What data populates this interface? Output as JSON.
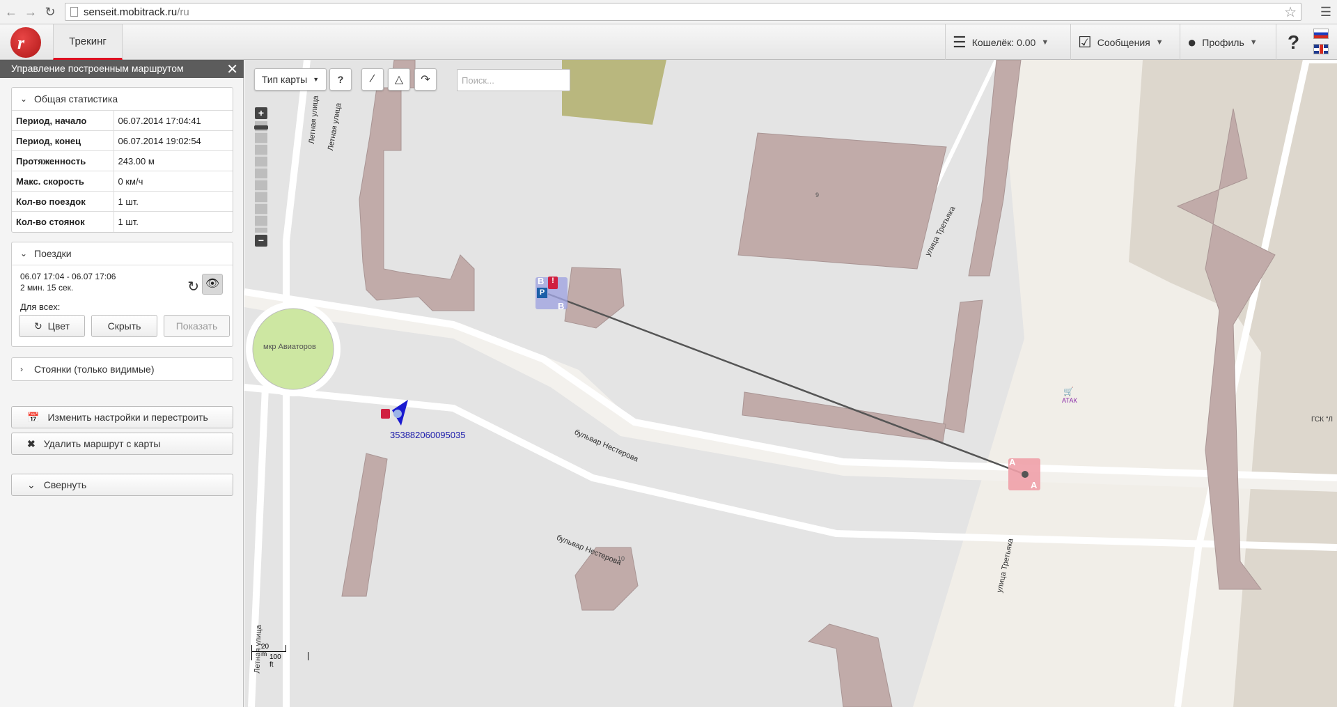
{
  "browser": {
    "url_host": "senseit.mobitrack.ru",
    "url_path": "/ru"
  },
  "header": {
    "tab_tracking": "Трекинг",
    "wallet": "Кошелёк: 0.00",
    "messages": "Сообщения",
    "profile": "Профиль",
    "help": "?"
  },
  "sidebar": {
    "title": "Управление построенным маршрутом",
    "general_stats": {
      "heading": "Общая статистика",
      "rows": [
        {
          "key": "Период, начало",
          "value": "06.07.2014 17:04:41"
        },
        {
          "key": "Период, конец",
          "value": "06.07.2014 19:02:54"
        },
        {
          "key": "Протяженность",
          "value": "243.00 м"
        },
        {
          "key": "Макс. скорость",
          "value": "0 км/ч"
        },
        {
          "key": "Кол-во поездок",
          "value": "1 шт."
        },
        {
          "key": "Кол-во стоянок",
          "value": "1 шт."
        }
      ]
    },
    "trips": {
      "heading": "Поездки",
      "trip_range": "06.07 17:04 - 06.07 17:06",
      "trip_duration": "2 мин. 15 сек.",
      "for_all": "Для всех:",
      "color_btn": "Цвет",
      "hide_btn": "Скрыть",
      "show_btn": "Показать"
    },
    "stops": {
      "heading": "Стоянки (только видимые)"
    },
    "change_settings_btn": "Изменить настройки и перестроить",
    "delete_route_btn": "Удалить маршрут с карты",
    "collapse_btn": "Свернуть"
  },
  "map": {
    "map_type_btn": "Тип карты",
    "help_btn": "?",
    "search_placeholder": "Поиск...",
    "device_id": "353882060095035",
    "labels": {
      "circle": "мкр Авиаторов",
      "street1": "бульвар Нестерова",
      "street2": "бульвар Нестерова",
      "street3": "улица Третьяка",
      "street4": "улица Третьяка",
      "street5": "Летная улица",
      "street6": "Летная улица",
      "street7": "Летная улица",
      "bldg9": "9",
      "bldg10": "10",
      "shop": "АТАК",
      "gsk": "ГСК \"Л"
    },
    "markers": {
      "b1": "B",
      "b2": "B",
      "p": "P",
      "a1": "A",
      "a2": "A"
    },
    "scale_m": "20 m",
    "scale_ft": "100 ft"
  }
}
